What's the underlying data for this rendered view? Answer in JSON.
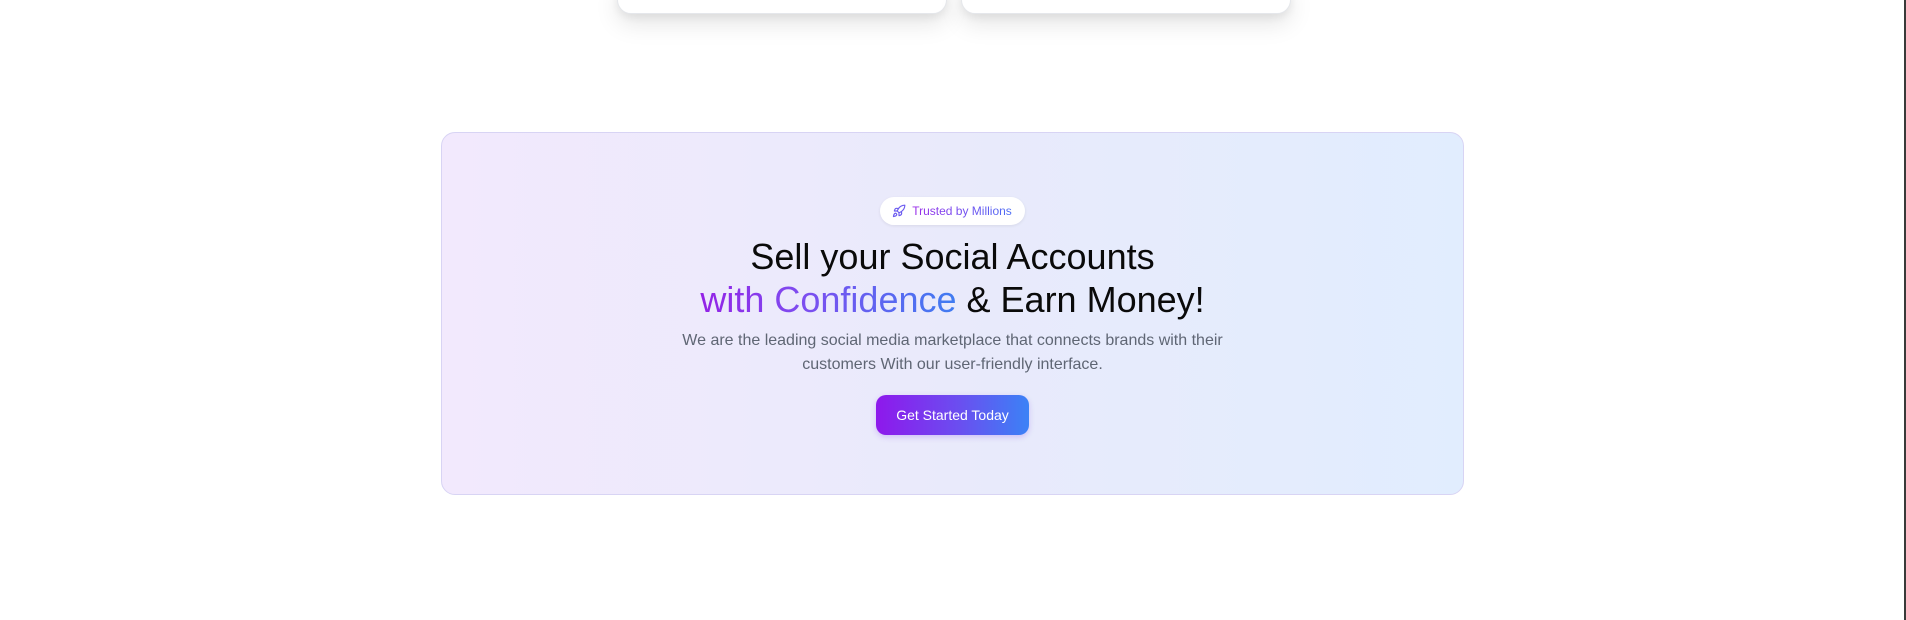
{
  "cta": {
    "badge": {
      "icon": "rocket-icon",
      "label": "Trusted by Millions"
    },
    "headline": {
      "line1": "Sell your Social Accounts",
      "highlight": "with Confidence",
      "rest": " & Earn Money!"
    },
    "description": "We are the leading social media marketplace that connects brands with their customers With our user-friendly interface.",
    "button_label": "Get Started Today"
  },
  "colors": {
    "accent_purple": "#9422e6",
    "accent_blue": "#3b82f6",
    "body_text": "#5f6674",
    "heading_text": "#0a0a0a"
  }
}
